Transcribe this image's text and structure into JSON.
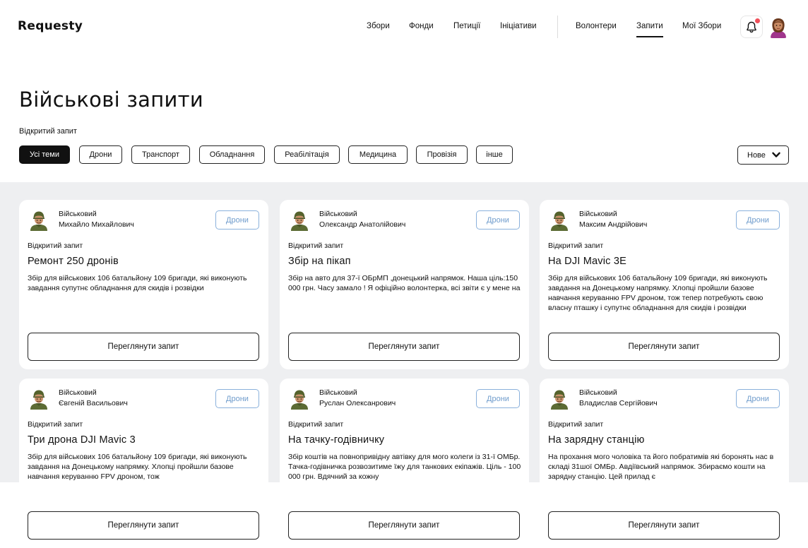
{
  "header": {
    "logo": "Requesty",
    "nav": [
      "Збори",
      "Фонди",
      "Петиції",
      "Ініціативи",
      "Волонтери",
      "Запити",
      "Мої Збори"
    ],
    "active_nav": "Запити"
  },
  "page": {
    "title": "Військові запити",
    "subtitle": "Відкритий запит",
    "chips": [
      "Усі теми",
      "Дрони",
      "Транспорт",
      "Обладнання",
      "Реабілітація",
      "Медицина",
      "Провізія",
      "інше"
    ],
    "active_chip": "Усі теми",
    "sort_label": "Нове"
  },
  "colors": {
    "accent": "#111111",
    "tag_blue": "#6f9ccc",
    "grid_bg": "#eeeff1",
    "notification": "#f0505a"
  },
  "cards": [
    {
      "role": "Військовий",
      "name": "Михайло Михайлович",
      "tag": "Дрони",
      "status": "Відкритий запит",
      "title": "Ремонт 250 дронів",
      "description": "Збір для військових 106 батальйону 109 бригади, які виконують завдання  супутнє обладнання для скидів і розвідки",
      "button": "Переглянути запит"
    },
    {
      "role": "Військовий",
      "name": "Олександр Анатолійович",
      "tag": "Дрони",
      "status": "Відкритий запит",
      "title": "Збір на пікап",
      "description": "Збір на авто для 37-ї ОБрМП ,донецький напрямок. Наша ціль:150 000 грн. Часу замало ! Я офіційно волонтерка, всі звіти є у мене на",
      "button": "Переглянути запит"
    },
    {
      "role": "Військовий",
      "name": "Максим Андрійович",
      "tag": "Дрони",
      "status": "Відкритий запит",
      "title": "На DJI Mavic 3E",
      "description": "Збір для військових 106 батальйону 109 бригади, які виконують завдання на Донецькому напрямку. Хлопці пройшли базове навчання керуванню FPV дроном, тож тепер потребують свою власну пташку і супутнє обладнання для скидів і розвідки",
      "button": "Переглянути запит"
    },
    {
      "role": "Військовий",
      "name": "Євгеній Васильович",
      "tag": "Дрони",
      "status": "Відкритий запит",
      "title": "Три дрона DJI Mavic 3",
      "description": "Збір для військових 106 батальйону 109 бригади, які виконують завдання на Донецькому напрямку. Хлопці пройшли базове навчання керуванню FPV дроном, тож",
      "button": "Переглянути запит"
    },
    {
      "role": "Військовий",
      "name": "Руслан Олексанрович",
      "tag": "Дрони",
      "status": "Відкритий запит",
      "title": "На тачку-годівничку",
      "description": "Збір коштів на повнопривідну автівку для мого колеги із 31-ї ОМБр. Тачка-годівничка розвозитиме їжу для танкових екіпажів. Ціль - 100 000 грн. Вдячний за кожну",
      "button": "Переглянути запит"
    },
    {
      "role": "Військовий",
      "name": "Владислав Сергійович",
      "tag": "Дрони",
      "status": "Відкритий запит",
      "title": "На зарядну станцію",
      "description": "На прохання мого чоловіка та його побратимів які боронять нас в складі 31шої ОМБр. Авдіївський напрямок. Збираємо кошти на зарядну станцію. Цей прилад є",
      "button": "Переглянути запит"
    }
  ]
}
